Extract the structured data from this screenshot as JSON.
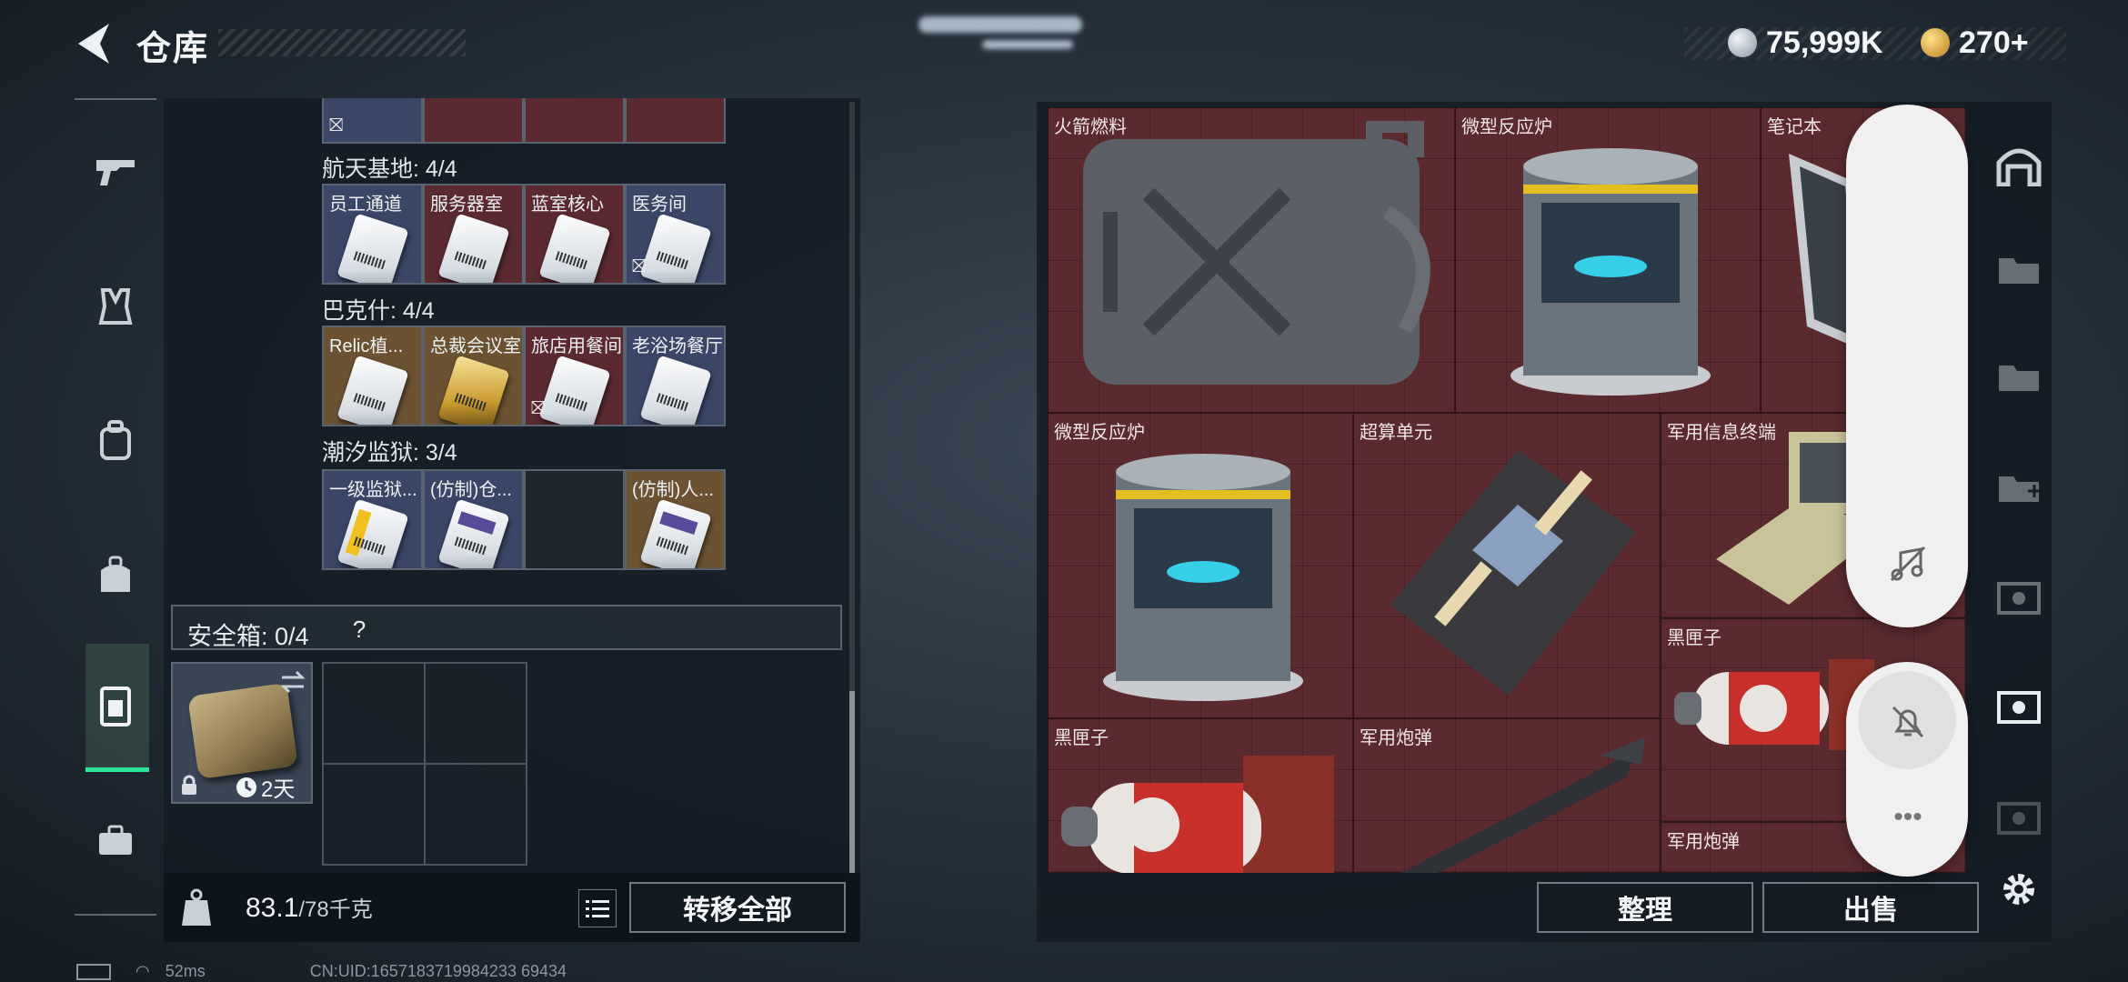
{
  "header": {
    "title": "仓库",
    "currency": [
      {
        "name": "silver-coin-icon",
        "value": "75,999K"
      },
      {
        "name": "gold-coin-icon",
        "value": "270+"
      }
    ]
  },
  "left_nav": [
    "gun-icon",
    "armor-vest-icon",
    "backpack-icon",
    "bag-icon",
    "locker-icon",
    "briefcase-icon"
  ],
  "stash": {
    "groups": [
      {
        "name": "航天基地: 4/4",
        "slots": [
          {
            "label": "员工通道",
            "bg": "blue"
          },
          {
            "label": "服务器室",
            "bg": "red"
          },
          {
            "label": "蓝室核心",
            "bg": "red"
          },
          {
            "label": "医务间",
            "bg": "blue",
            "nolink": true
          }
        ]
      },
      {
        "name": "巴克什: 4/4",
        "slots": [
          {
            "label": "Relic植...",
            "bg": "gold"
          },
          {
            "label": "总裁会议室",
            "bg": "gold"
          },
          {
            "label": "旅店用餐间",
            "bg": "red",
            "nolink": true
          },
          {
            "label": "老浴场餐厅",
            "bg": "blue"
          }
        ]
      },
      {
        "name": "潮汐监狱: 3/4",
        "slots": [
          {
            "label": "一级监狱...",
            "bg": "blue"
          },
          {
            "label": "(仿制)仓...",
            "bg": "blue"
          },
          {
            "label": "",
            "bg": "empty"
          },
          {
            "label": "(仿制)人...",
            "bg": "gold"
          }
        ]
      }
    ],
    "safe_box_label": "安全箱: 0/4",
    "safe_box_help": "?",
    "case_timer": "2天",
    "weight_value": "83.1",
    "weight_limit": "/78千克",
    "transfer_all": "转移全部"
  },
  "storage": {
    "items": [
      {
        "label": "火箭燃料"
      },
      {
        "label": "微型反应炉"
      },
      {
        "label": "笔记本"
      },
      {
        "label": "微型反应炉"
      },
      {
        "label": "超算单元"
      },
      {
        "label": "军用信息终端"
      },
      {
        "label": "黑匣子"
      },
      {
        "label": "黑匣子"
      },
      {
        "label": "军用炮弹"
      },
      {
        "label": "军用炮弹"
      }
    ],
    "sort_button": "整理",
    "sell_button": "出售"
  },
  "status_bar": {
    "ping": "52ms",
    "uid": "CN:UID:1657183719984233 69434"
  },
  "colors": {
    "accent": "#2ee39a",
    "storage_bg": "#5a2a2e"
  }
}
